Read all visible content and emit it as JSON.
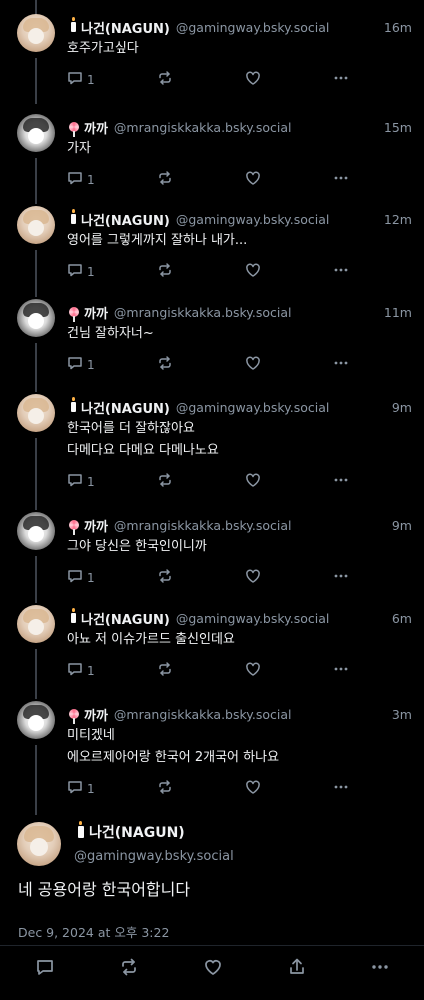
{
  "posts": [
    {
      "author": "나건(NAGUN)",
      "handle": "@gamingway.bsky.social",
      "time": "16m",
      "lines": [
        "호주가고싶다"
      ],
      "reply_count": "1",
      "avatar": "nagun-avatar",
      "badge": "candle-icon"
    },
    {
      "author": "까까",
      "handle": "@mrangiskkakka.bsky.social",
      "time": "15m",
      "lines": [
        "가자"
      ],
      "reply_count": "1",
      "avatar": "kkakka-avatar",
      "badge": "lollipop-icon"
    },
    {
      "author": "나건(NAGUN)",
      "handle": "@gamingway.bsky.social",
      "time": "12m",
      "lines": [
        "영어를 그렇게까지 잘하나 내가..."
      ],
      "reply_count": "1",
      "avatar": "nagun-avatar",
      "badge": "candle-icon"
    },
    {
      "author": "까까",
      "handle": "@mrangiskkakka.bsky.social",
      "time": "11m",
      "lines": [
        "건님 잘하자너~"
      ],
      "reply_count": "1",
      "avatar": "kkakka-avatar",
      "badge": "lollipop-icon"
    },
    {
      "author": "나건(NAGUN)",
      "handle": "@gamingway.bsky.social",
      "time": "9m",
      "lines": [
        "한국어를 더 잘하잖아요",
        "다메다요 다메요 다메나노요"
      ],
      "reply_count": "1",
      "avatar": "nagun-avatar",
      "badge": "candle-icon"
    },
    {
      "author": "까까",
      "handle": "@mrangiskkakka.bsky.social",
      "time": "9m",
      "lines": [
        "그야 당신은 한국인이니까"
      ],
      "reply_count": "1",
      "avatar": "kkakka-avatar",
      "badge": "lollipop-icon"
    },
    {
      "author": "나건(NAGUN)",
      "handle": "@gamingway.bsky.social",
      "time": "6m",
      "lines": [
        "아뇨 저 이슈가르드 출신인데요"
      ],
      "reply_count": "1",
      "avatar": "nagun-avatar",
      "badge": "candle-icon"
    },
    {
      "author": "까까",
      "handle": "@mrangiskkakka.bsky.social",
      "time": "3m",
      "lines": [
        "미티겠네",
        "에오르제아어랑 한국어 2개국어 하나요"
      ],
      "reply_count": "1",
      "avatar": "kkakka-avatar",
      "badge": "lollipop-icon"
    }
  ],
  "focused": {
    "author": "나건(NAGUN)",
    "handle": "@gamingway.bsky.social",
    "text": "네 공용어랑 한국어합니다",
    "date": "Dec 9, 2024 at 오후 3:22"
  },
  "colors": {
    "background": "#000000",
    "text": "#f1f3f5",
    "muted": "#8b96a3",
    "thread_line": "#3a3f47"
  },
  "icons": {
    "reply": "reply-icon",
    "repost": "repost-icon",
    "like": "heart-icon",
    "more": "more-icon",
    "share": "share-icon"
  }
}
